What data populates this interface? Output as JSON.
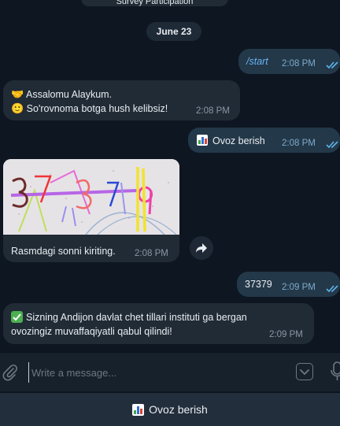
{
  "top_pill_text": "Survey Participation",
  "date_separator": "June 23",
  "messages": [
    {
      "id": "start",
      "direction": "out",
      "text": "/start",
      "time": "2:08 PM"
    },
    {
      "id": "greeting",
      "direction": "in",
      "line1": "Assalomu Alaykum.",
      "line2": "So'rovnoma botga hush kelibsiz!",
      "time": "2:08 PM"
    },
    {
      "id": "vote1",
      "direction": "out",
      "text": "Ovoz berish",
      "time": "2:08 PM"
    },
    {
      "id": "captcha",
      "direction": "in",
      "caption": "Rasmdagi sonni kiriting.",
      "time": "2:08 PM"
    },
    {
      "id": "answer",
      "direction": "out",
      "text": "37379",
      "time": "2:09 PM"
    },
    {
      "id": "confirm",
      "direction": "in",
      "line1": "Sizning Andijon davlat chet tillari instituti ga bergan",
      "line2": "ovozingiz muvaffaqiyatli qabul qilindi!",
      "time": "2:09 PM"
    }
  ],
  "composer": {
    "placeholder": "Write a message..."
  },
  "reply_keyboard": {
    "button_label": "Ovoz berish"
  },
  "icons": {
    "attach": "paperclip-icon",
    "emoji_panel": "chevron-down-icon",
    "mic": "microphone-icon",
    "forward": "forward-icon",
    "read": "double-check-icon"
  },
  "colors": {
    "background": "#0e1621",
    "incoming_bubble": "#212b36",
    "outgoing_bubble": "#233849",
    "check": "#5fb5ec",
    "composer": "#17212b",
    "keyboard": "#232e3c"
  }
}
